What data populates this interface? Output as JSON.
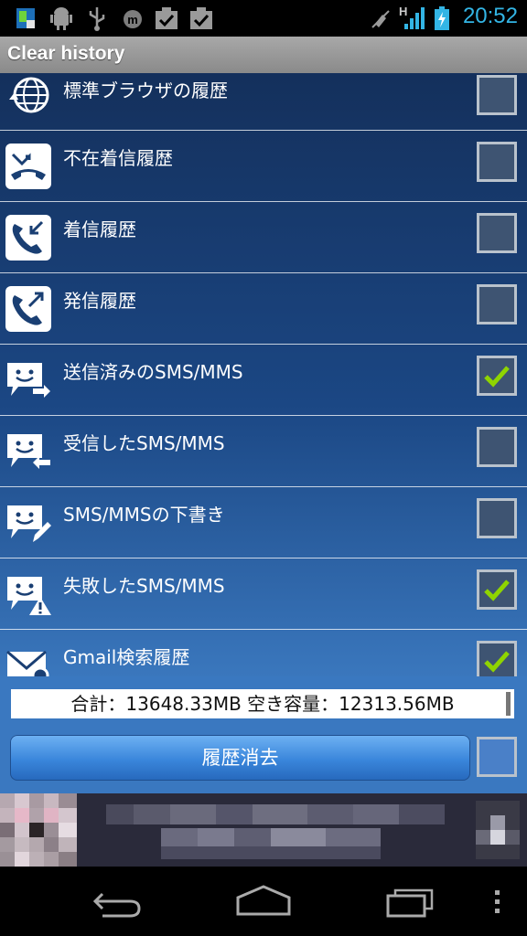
{
  "status_bar": {
    "time": "20:52",
    "network_type": "H",
    "icons": [
      "app-icon",
      "android-debug-icon",
      "usb-icon",
      "m-icon",
      "check-icon",
      "check-icon",
      "mute-icon",
      "signal-icon",
      "battery-charging-icon"
    ],
    "time_color": "#33b5e5"
  },
  "title_bar": {
    "title": "Clear history"
  },
  "list": {
    "items": [
      {
        "label": "標準ブラウザの履歴",
        "icon": "browser-history-icon",
        "checked": false
      },
      {
        "label": "不在着信履歴",
        "icon": "missed-call-icon",
        "checked": false
      },
      {
        "label": "着信履歴",
        "icon": "incoming-call-icon",
        "checked": false
      },
      {
        "label": "発信履歴",
        "icon": "outgoing-call-icon",
        "checked": false
      },
      {
        "label": "送信済みのSMS/MMS",
        "icon": "sent-sms-icon",
        "checked": true
      },
      {
        "label": "受信したSMS/MMS",
        "icon": "received-sms-icon",
        "checked": false
      },
      {
        "label": "SMS/MMSの下書き",
        "icon": "draft-sms-icon",
        "checked": false
      },
      {
        "label": "失敗したSMS/MMS",
        "icon": "failed-sms-icon",
        "checked": true
      },
      {
        "label": "Gmail検索履歴",
        "icon": "gmail-search-icon",
        "checked": true
      }
    ]
  },
  "panel": {
    "total_text": "合計：13648.33MB  空き容量：12313.56MB",
    "clear_button": "履歴消去",
    "select_all_checked": false
  },
  "colors": {
    "accent": "#33b5e5",
    "check": "#8fd400",
    "button": "#3a86db"
  }
}
